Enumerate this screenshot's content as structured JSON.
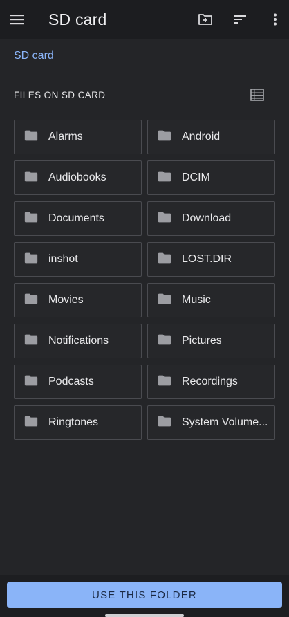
{
  "appbar": {
    "title": "SD card",
    "menu_icon": "menu-icon",
    "actions": [
      {
        "name": "new-folder-icon"
      },
      {
        "name": "sort-icon"
      },
      {
        "name": "more-vert-icon"
      }
    ]
  },
  "breadcrumb": {
    "label": "SD card"
  },
  "section": {
    "title": "FILES ON SD CARD",
    "view_icon": "list-view-icon"
  },
  "folders": [
    {
      "name": "Alarms"
    },
    {
      "name": "Android"
    },
    {
      "name": "Audiobooks"
    },
    {
      "name": "DCIM"
    },
    {
      "name": "Documents"
    },
    {
      "name": "Download"
    },
    {
      "name": "inshot"
    },
    {
      "name": "LOST.DIR"
    },
    {
      "name": "Movies"
    },
    {
      "name": "Music"
    },
    {
      "name": "Notifications"
    },
    {
      "name": "Pictures"
    },
    {
      "name": "Podcasts"
    },
    {
      "name": "Recordings"
    },
    {
      "name": "Ringtones"
    },
    {
      "name": "System Volume..."
    }
  ],
  "footer": {
    "button_label": "USE THIS FOLDER"
  },
  "colors": {
    "background": "#242528",
    "appbar": "#1c1d20",
    "accent": "#8ab4f8",
    "tile_border": "#4a4b50",
    "folder_icon": "#9c9da2"
  }
}
